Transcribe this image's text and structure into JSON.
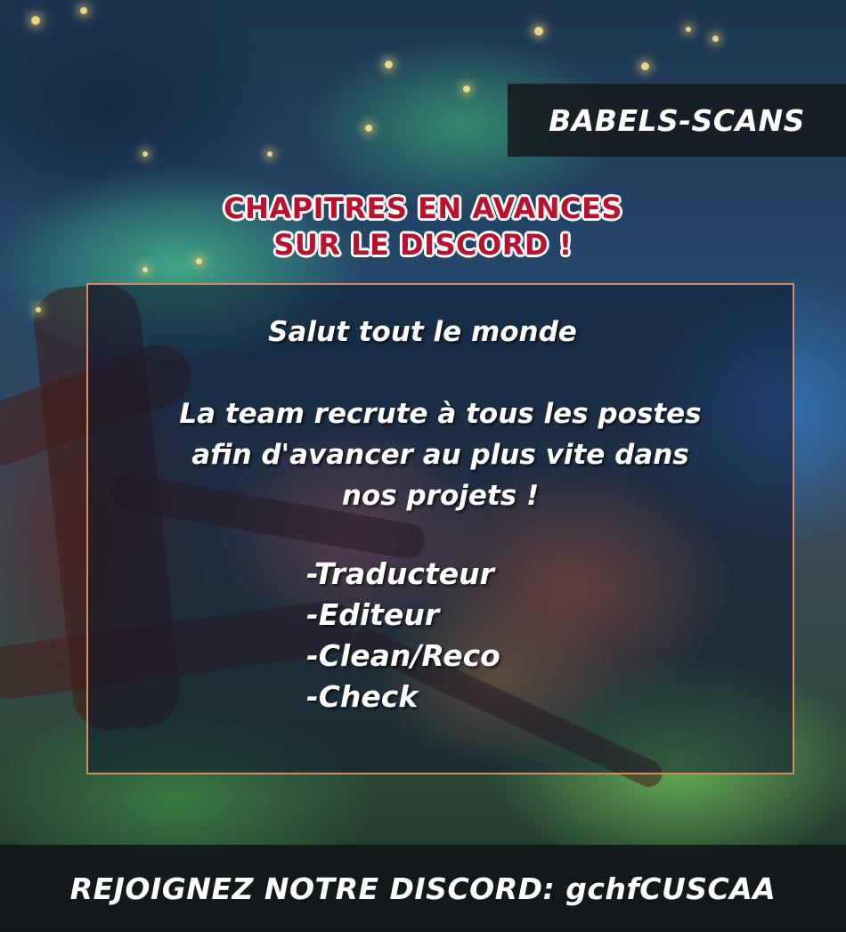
{
  "banner": {
    "site_name": "BABELS-SCANS"
  },
  "headline": {
    "line1": "CHAPITRES EN AVANCES",
    "line2": "SUR LE DISCORD !"
  },
  "message": {
    "greeting": "Salut tout le monde",
    "body_line1": "La team recrute à tous les postes",
    "body_line2": "afin d'avancer au plus vite dans",
    "body_line3": "nos projets !",
    "roles": [
      "-Traducteur",
      "-Editeur",
      "-Clean/Reco",
      "-Check"
    ]
  },
  "footer": {
    "discord_text": "REJOIGNEZ NOTRE DISCORD: gchfCUSCAA"
  },
  "colors": {
    "headline_red": "#b8122e",
    "panel_border": "#d98760",
    "banner_bg": "#16191e"
  }
}
